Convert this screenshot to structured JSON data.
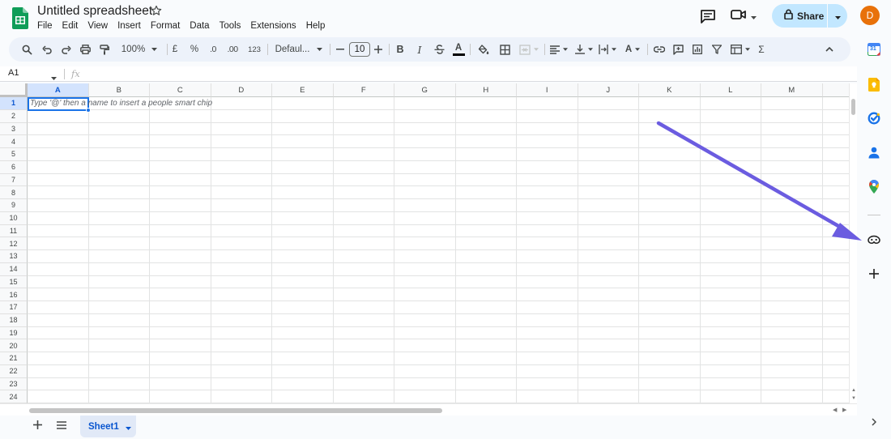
{
  "app": {
    "title": "Untitled spreadsheet",
    "menu": [
      "File",
      "Edit",
      "View",
      "Insert",
      "Format",
      "Data",
      "Tools",
      "Extensions",
      "Help"
    ],
    "share_label": "Share",
    "avatar_initial": "D",
    "avatar_color": "#e8710a",
    "accent_color": "#1a73e8",
    "share_bg": "#c2e7ff"
  },
  "toolbar": {
    "zoom": "100%",
    "currency": "£",
    "percent": "%",
    "decimal_decrease": ".0",
    "decimal_increase": ".00",
    "number_format": "123",
    "font_family": "Defaul...",
    "font_size": "10",
    "icons": [
      "search-icon",
      "undo-icon",
      "redo-icon",
      "print-icon",
      "paint-format-icon",
      "minus-icon",
      "plus-icon",
      "bold-icon",
      "italic-icon",
      "strikethrough-icon",
      "text-color-icon",
      "fill-color-icon",
      "borders-icon",
      "merge-cells-icon",
      "align-left-icon",
      "vertical-align-icon",
      "text-wrap-icon",
      "text-rotation-icon",
      "link-icon",
      "comment-icon",
      "chart-icon",
      "filter-icon",
      "filter-views-icon",
      "functions-icon",
      "collapse-icon"
    ]
  },
  "formula_bar": {
    "cell_ref": "A1",
    "fx": "fx"
  },
  "grid": {
    "columns": [
      "A",
      "B",
      "C",
      "D",
      "E",
      "F",
      "G",
      "H",
      "I",
      "J",
      "K",
      "L",
      "M"
    ],
    "rows": [
      "1",
      "2",
      "3",
      "4",
      "5",
      "6",
      "7",
      "8",
      "9",
      "10",
      "11",
      "12",
      "13",
      "14",
      "15",
      "16",
      "17",
      "18",
      "19",
      "20",
      "21",
      "22",
      "23",
      "24"
    ],
    "selected_cell": "A1",
    "cell_hint": "Type '@' then a name to insert a people smart chip"
  },
  "sheets": {
    "tabs": [
      {
        "label": "Sheet1",
        "active": true
      }
    ]
  },
  "side_panel": {
    "icons": [
      "calendar-icon",
      "keep-icon",
      "tasks-icon",
      "contacts-icon",
      "maps-icon",
      "gemini-icon",
      "add-addon-icon"
    ],
    "calendar_day": "31"
  },
  "annotation": {
    "arrow_color": "#6b5ce0"
  }
}
